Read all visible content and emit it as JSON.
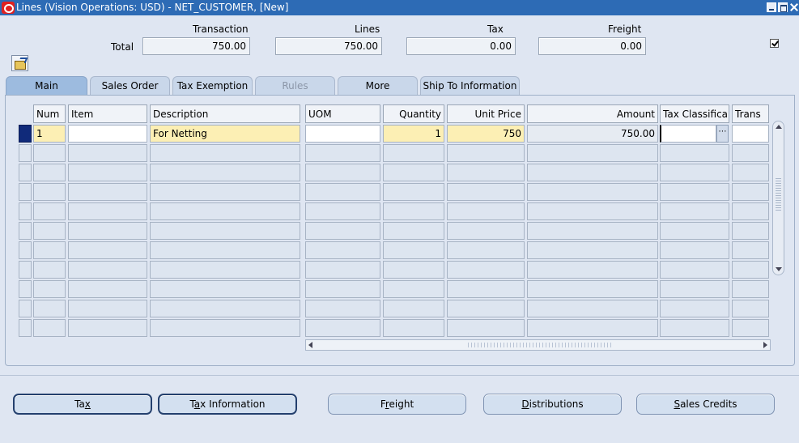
{
  "window": {
    "title": "Lines (Vision Operations: USD) - NET_CUSTOMER, [New]"
  },
  "totals": {
    "row_label": "Total",
    "transaction": {
      "label": "Transaction",
      "value": "750.00"
    },
    "lines": {
      "label": "Lines",
      "value": "750.00"
    },
    "tax": {
      "label": "Tax",
      "value": "0.00"
    },
    "freight": {
      "label": "Freight",
      "value": "0.00"
    }
  },
  "tabs": [
    {
      "label": "Main",
      "state": "active"
    },
    {
      "label": "Sales Order",
      "state": "normal"
    },
    {
      "label": "Tax Exemption",
      "state": "normal"
    },
    {
      "label": "Rules",
      "state": "disabled"
    },
    {
      "label": "More",
      "state": "normal"
    },
    {
      "label": "Ship To Information",
      "state": "normal"
    }
  ],
  "table": {
    "columns": [
      "Num",
      "Item",
      "Description",
      "UOM",
      "Quantity",
      "Unit Price",
      "Amount",
      "Tax Classifica",
      "Trans"
    ],
    "rows": [
      {
        "num": "1",
        "item": "",
        "description": "For Netting",
        "uom": "",
        "quantity": "1",
        "unit_price": "750",
        "amount": "750.00",
        "tax_classification": "",
        "trans": ""
      }
    ]
  },
  "buttons": {
    "tax": {
      "pre": "Ta",
      "key": "x",
      "post": ""
    },
    "tax_information": {
      "pre": "T",
      "key": "a",
      "post": "x Information"
    },
    "freight": {
      "pre": "F",
      "key": "r",
      "post": "eight"
    },
    "distributions": {
      "pre": "",
      "key": "D",
      "post": "istributions"
    },
    "sales_credits": {
      "pre": "",
      "key": "S",
      "post": "ales Credits"
    }
  },
  "colors": {
    "title_bar": "#2d6bb5",
    "active_tab": "#9dbbdf",
    "required_field": "#fcefb4",
    "row_indicator": "#102a7a"
  }
}
